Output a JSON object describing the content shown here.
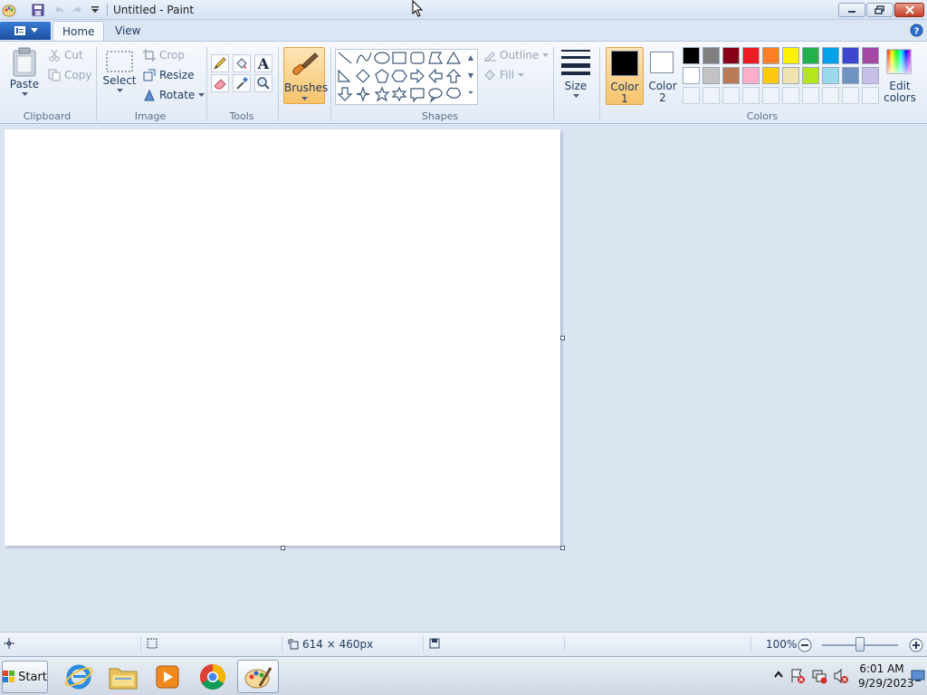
{
  "window": {
    "title": "Untitled - Paint",
    "quick_access": [
      "paint-app-icon",
      "save-icon",
      "undo-icon",
      "redo-icon",
      "customize-dropdown-icon"
    ]
  },
  "tabs": [
    {
      "label": "Home",
      "active": true
    },
    {
      "label": "View",
      "active": false
    }
  ],
  "ribbon": {
    "clipboard": {
      "paste": "Paste",
      "cut": "Cut",
      "copy": "Copy",
      "group": "Clipboard"
    },
    "image": {
      "select": "Select",
      "crop": "Crop",
      "resize": "Resize",
      "rotate": "Rotate",
      "group": "Image"
    },
    "tools": {
      "group": "Tools",
      "items": [
        "pencil-icon",
        "fill-bucket-icon",
        "text-icon",
        "eraser-icon",
        "color-picker-icon",
        "magnifier-icon"
      ]
    },
    "brushes": {
      "label": "Brushes"
    },
    "shapes": {
      "outline": "Outline",
      "fill": "Fill",
      "group": "Shapes"
    },
    "size": {
      "label": "Size"
    },
    "colors": {
      "color1_line1": "Color",
      "color1_line2": "1",
      "color2_line1": "Color",
      "color2_line2": "2",
      "edit_line1": "Edit",
      "edit_line2": "colors",
      "group": "Colors",
      "color1": "#000000",
      "color2": "#ffffff",
      "palette_row1": [
        "#000000",
        "#7f7f7f",
        "#880015",
        "#ed1c24",
        "#ff7f27",
        "#fff200",
        "#22b14c",
        "#00a2e8",
        "#3f48cc",
        "#a349a4"
      ],
      "palette_row2": [
        "#ffffff",
        "#c3c3c3",
        "#b97a57",
        "#ffaec9",
        "#ffc90e",
        "#efe4b0",
        "#b5e61d",
        "#99d9ea",
        "#7092be",
        "#c8bfe7"
      ]
    }
  },
  "statusbar": {
    "canvas_size": "614 × 460px",
    "zoom": "100%"
  },
  "taskbar": {
    "start": "Start",
    "apps": [
      "internet-explorer-icon",
      "file-explorer-icon",
      "media-player-icon",
      "chrome-icon",
      "paint-icon"
    ],
    "time": "6:01 AM",
    "date": "9/29/2023"
  }
}
